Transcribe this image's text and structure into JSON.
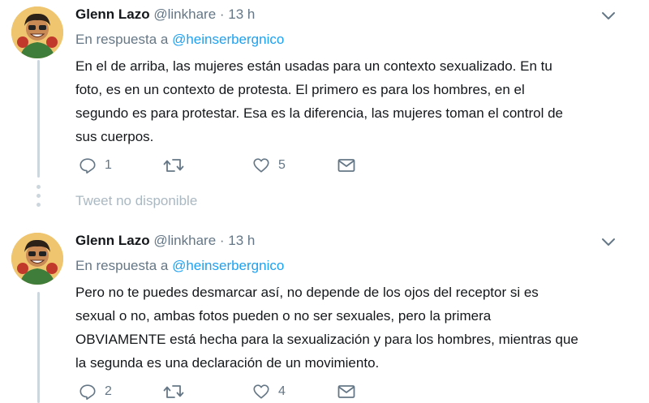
{
  "tweets": [
    {
      "name": "Glenn Lazo",
      "handle": "@linkhare",
      "separator": "·",
      "time": "13 h",
      "reply_prefix": "En respuesta a",
      "reply_mention": "@heinserbergnico",
      "lines": [
        "En el de arriba, las mujeres están usadas para un contexto sexualizado. En tu",
        "foto, es en un contexto de protesta. El primero es para los hombres, en el",
        "segundo es para protestar. Esa es la diferencia, las mujeres toman el control de",
        "sus cuerpos."
      ],
      "replies": "1",
      "retweets": "",
      "likes": "5"
    },
    {
      "name": "Glenn Lazo",
      "handle": "@linkhare",
      "separator": "·",
      "time": "13 h",
      "reply_prefix": "En respuesta a",
      "reply_mention": "@heinserbergnico",
      "lines": [
        "Pero no te puedes desmarcar así, no depende de los ojos del receptor si es",
        "sexual o no, ambas fotos pueden o no ser sexuales, pero la primera",
        "OBVIAMENTE está hecha para la sexualización y para los hombres, mientras que",
        "la segunda es una declaración de un movimiento."
      ],
      "replies": "2",
      "retweets": "",
      "likes": "4"
    }
  ],
  "unavailable_text": "Tweet no disponible",
  "icons": {
    "reply": "reply-icon",
    "retweet": "retweet-icon",
    "like": "heart-icon",
    "dm": "envelope-icon",
    "more": "chevron-down-icon"
  },
  "colors": {
    "text": "#14171a",
    "secondary": "#657786",
    "link": "#1da1f2",
    "thread_line": "#ccd6dd",
    "unavailable": "#aab8c2"
  }
}
